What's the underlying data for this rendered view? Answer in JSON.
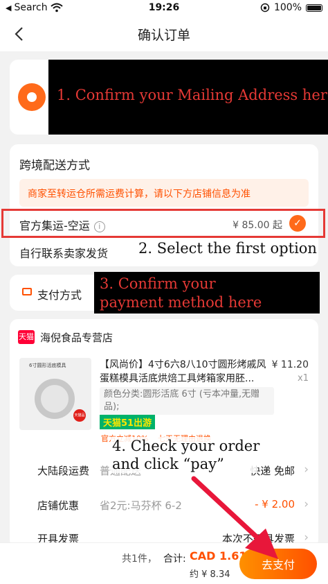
{
  "status_bar": {
    "carrier": "Search",
    "time": "19:26",
    "battery": "100%"
  },
  "nav": {
    "title": "确认订单"
  },
  "annotations": {
    "address": "1. Confirm your Mailing Address here",
    "shipping": "2. Select the first option",
    "payment_line1": "3. Confirm your",
    "payment_line2": "payment method here",
    "order_line1": "4. Check your order",
    "order_line2": "and click “pay”"
  },
  "shipping": {
    "title": "跨境配送方式",
    "notice": "商家至转运仓所需运费计算，请以下方店铺信息为准",
    "option1_label": "官方集运-空运",
    "option1_price": "¥ 85.00 起",
    "option2_label": "自行联系卖家发货"
  },
  "payment": {
    "label": "支付方式"
  },
  "shop": {
    "badge": "天猫",
    "name": "海倪食品专营店",
    "product": {
      "title": "【风尚价】4寸6六8八10寸圆形烤戚风蛋糕模具活底烘焙工具烤箱家用胚...",
      "price": "¥ 11.20",
      "qty": "x1",
      "sku": "颜色分类:圆形活底 6寸 (亏本冲量,无赠品);",
      "promo": "天猫51出游",
      "tag1": "官方立减10%",
      "tag2": "七天无理由退换",
      "image_header": "6寸圆形活底模具",
      "image_badge": "天猫品"
    },
    "rows": [
      {
        "label": "大陆段运费",
        "value": "普通配送",
        "right": "快递 免邮"
      },
      {
        "label": "店铺优惠",
        "value": "省2元:马芬杯 6-2",
        "right": "- ¥ 2.00"
      },
      {
        "label": "开具发票",
        "value": "",
        "right": "本次不开具发票"
      }
    ]
  },
  "bottom": {
    "count": "共1件，",
    "total_label": "合计:",
    "total": "CAD 1.61",
    "approx": "约 ¥ 8.34",
    "pay_button": "去支付"
  },
  "colors": {
    "accent": "#ff5000",
    "annotation": "#e53935"
  }
}
